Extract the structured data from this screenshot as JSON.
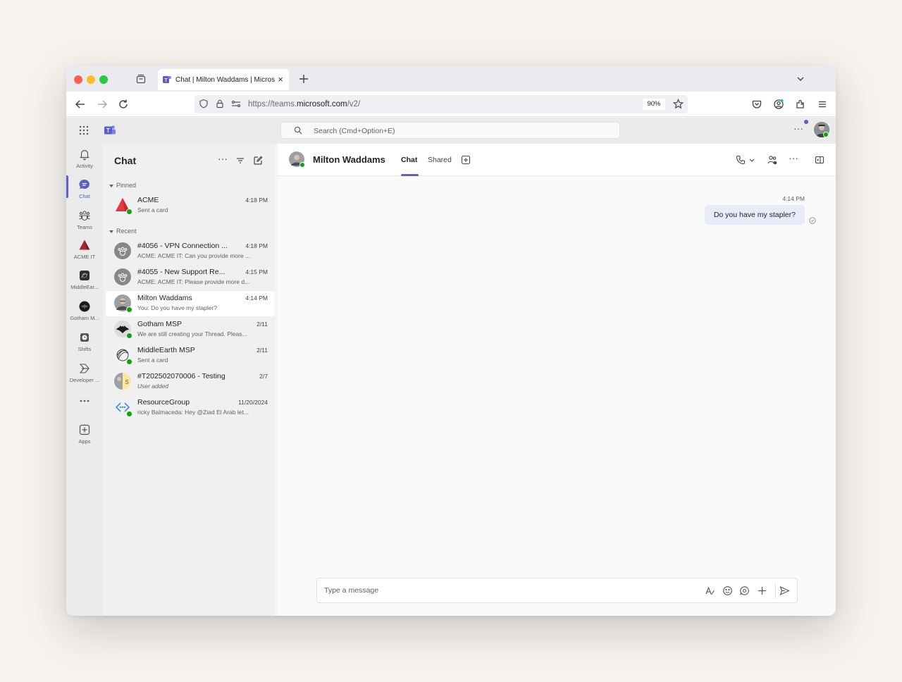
{
  "browser": {
    "tab_title": "Chat | Milton Waddams | Microsoft Teams",
    "url_prefix": "https://teams.",
    "url_domain": "microsoft.com",
    "url_path": "/v2/",
    "zoom": "90%"
  },
  "teams": {
    "search_placeholder": "Search (Cmd+Option+E)",
    "rail": [
      {
        "label": "Activity",
        "icon": "bell-icon"
      },
      {
        "label": "Chat",
        "icon": "chat-icon",
        "active": true
      },
      {
        "label": "Teams",
        "icon": "teams-icon"
      },
      {
        "label": "ACME IT",
        "icon": "acme-it-icon"
      },
      {
        "label": "MiddleEar...",
        "icon": "middleearth-icon"
      },
      {
        "label": "Gotham M...",
        "icon": "gotham-icon"
      },
      {
        "label": "Shifts",
        "icon": "shifts-icon"
      },
      {
        "label": "Developer ...",
        "icon": "developer-icon"
      },
      {
        "label": "...",
        "icon": "more-apps-icon"
      },
      {
        "label": "Apps",
        "icon": "apps-icon"
      }
    ]
  },
  "chat_list": {
    "title": "Chat",
    "pinned_label": "Pinned",
    "recent_label": "Recent",
    "pinned": [
      {
        "name": "ACME",
        "time": "4:18 PM",
        "preview": "Sent a card"
      }
    ],
    "recent": [
      {
        "name": "#4056 - VPN Connection ...",
        "time": "4:18 PM",
        "preview": "ACME: ACME IT: Can you provide more ..."
      },
      {
        "name": "#4055 - New Support Re...",
        "time": "4:15 PM",
        "preview": "ACME: ACME IT: Please provide more d..."
      },
      {
        "name": "Milton Waddams",
        "time": "4:14 PM",
        "preview": "You: Do you have my stapler?"
      },
      {
        "name": "Gotham MSP",
        "time": "2/11",
        "preview": "We are still creating your Thread. Pleas..."
      },
      {
        "name": "MiddleEarth MSP",
        "time": "2/11",
        "preview": "Sent a card"
      },
      {
        "name": "#T202502070006 - Testing",
        "time": "2/7",
        "preview": "User added"
      },
      {
        "name": "ResourceGroup",
        "time": "11/20/2024",
        "preview": "ricky Balmaceda: Hey @Ziad El Arab let..."
      }
    ]
  },
  "conversation": {
    "name": "Milton Waddams",
    "tab_chat": "Chat",
    "tab_shared": "Shared",
    "messages": [
      {
        "time": "4:14 PM",
        "text": "Do you have my stapler?"
      }
    ],
    "composer_placeholder": "Type a message"
  },
  "colors": {
    "accent": "#5b5fc7",
    "presence_available": "#13a10e",
    "bubble_self": "#e8ebfa"
  }
}
